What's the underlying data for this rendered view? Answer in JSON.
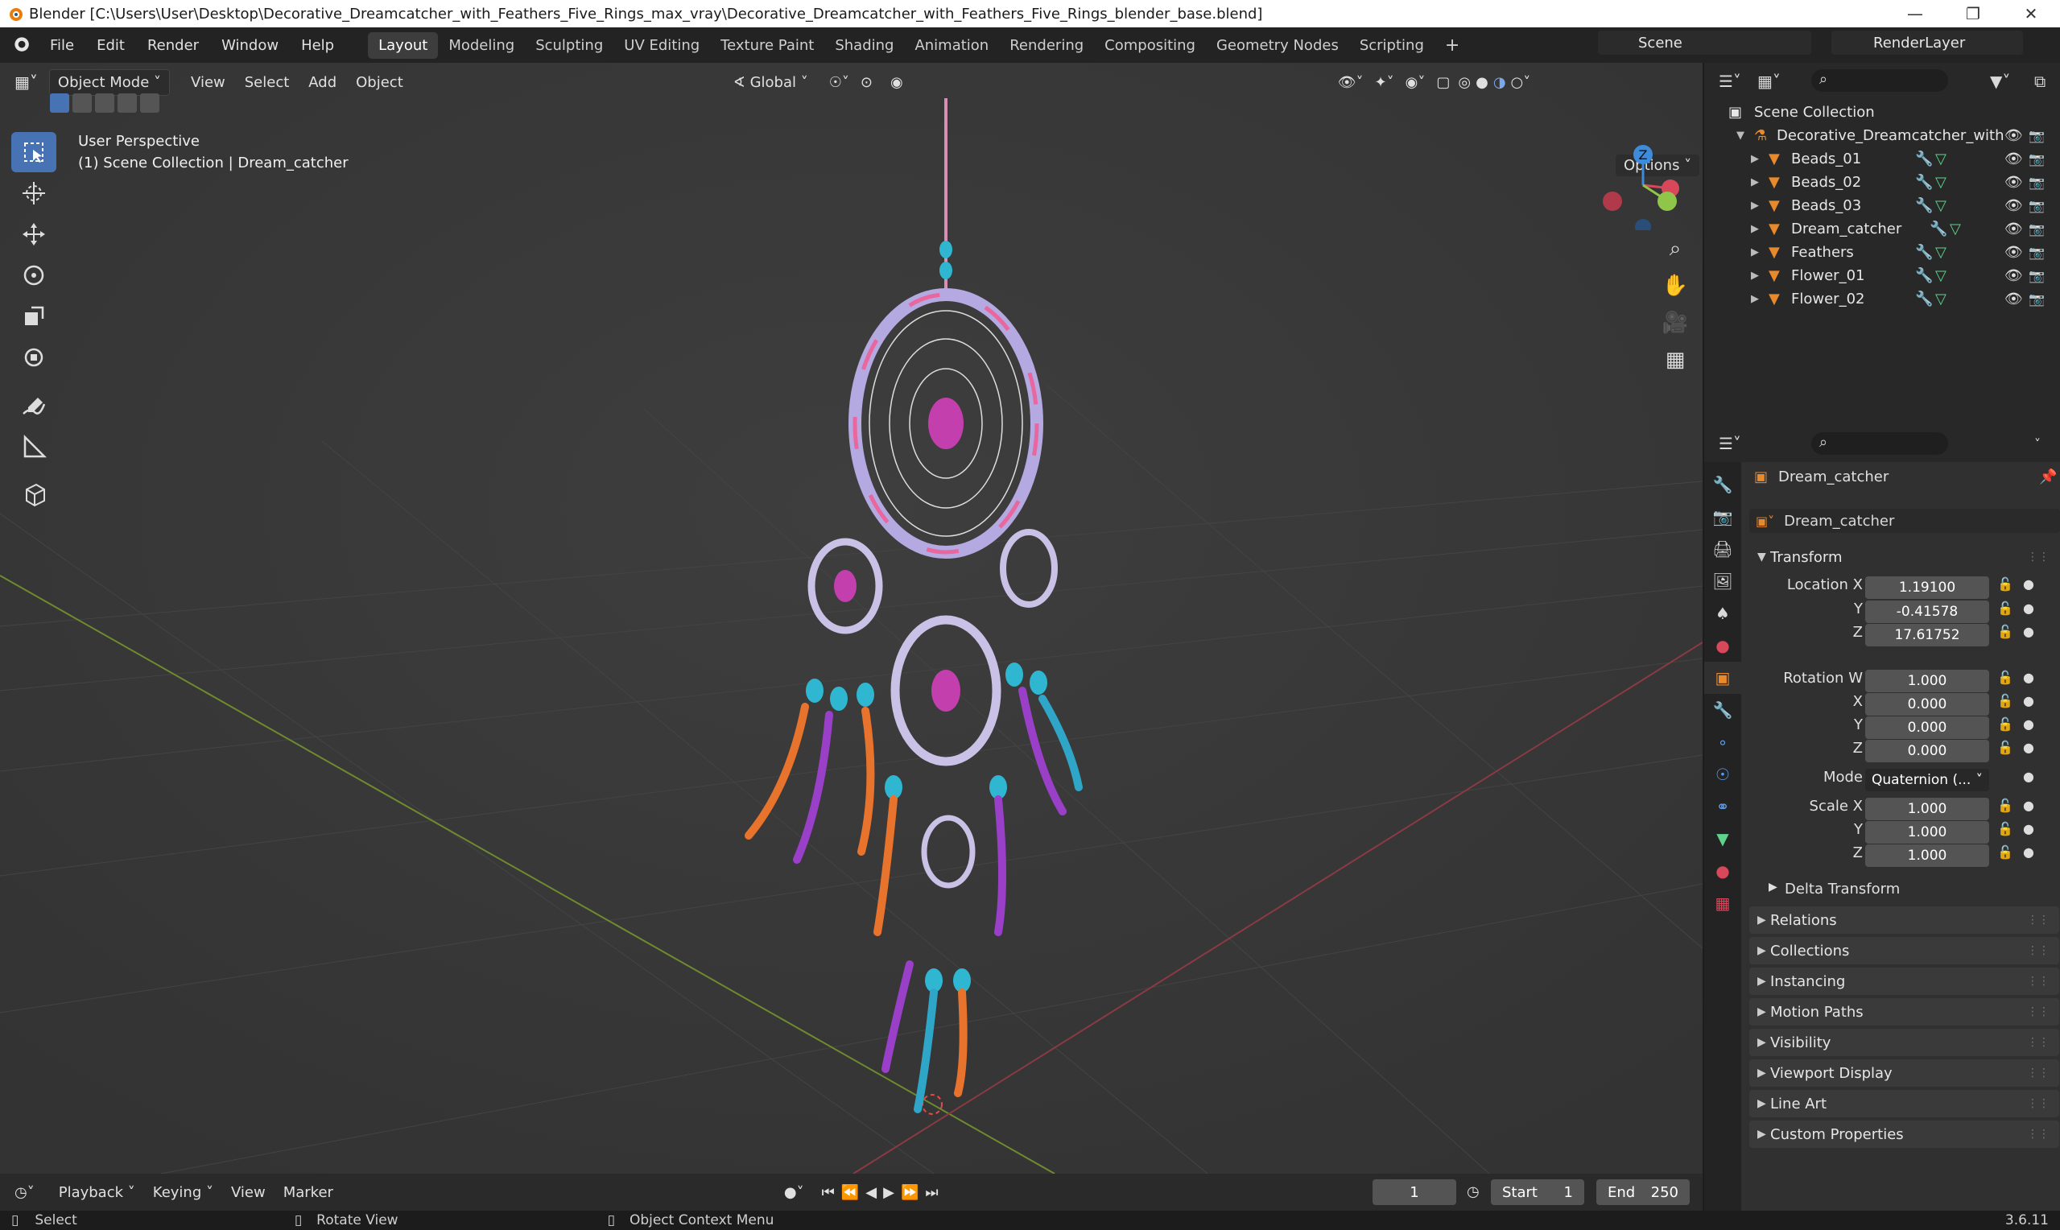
{
  "window": {
    "title": "Blender [C:\\Users\\User\\Desktop\\Decorative_Dreamcatcher_with_Feathers_Five_Rings_max_vray\\Decorative_Dreamcatcher_with_Feathers_Five_Rings_blender_base.blend]"
  },
  "menu": {
    "items": [
      "File",
      "Edit",
      "Render",
      "Window",
      "Help"
    ],
    "workspaces": [
      "Layout",
      "Modeling",
      "Sculpting",
      "UV Editing",
      "Texture Paint",
      "Shading",
      "Animation",
      "Rendering",
      "Compositing",
      "Geometry Nodes",
      "Scripting"
    ],
    "active_workspace": "Layout",
    "scene": "Scene",
    "render_layer": "RenderLayer"
  },
  "viewport": {
    "mode": "Object Mode",
    "menus": [
      "View",
      "Select",
      "Add",
      "Object"
    ],
    "transform_orientation": "Global",
    "options_label": "Options",
    "perspective": "User Perspective",
    "context": "(1) Scene Collection | Dream_catcher",
    "gizmo_axis": "Z"
  },
  "outliner": {
    "root": "Scene Collection",
    "collection": "Decorative_Dreamcatcher_with",
    "objects": [
      "Beads_01",
      "Beads_02",
      "Beads_03",
      "Dream_catcher",
      "Feathers",
      "Flower_01",
      "Flower_02"
    ]
  },
  "properties": {
    "object_name": "Dream_catcher",
    "datablock": "Dream_catcher",
    "transform_header": "Transform",
    "location": {
      "label": "Location X",
      "x": "1.19100",
      "y": "-0.41578",
      "z": "17.61752"
    },
    "rotation": {
      "label": "Rotation W",
      "w": "1.000",
      "x": "0.000",
      "y": "0.000",
      "z": "0.000"
    },
    "mode": {
      "label": "Mode",
      "value": "Quaternion (..."
    },
    "scale": {
      "label": "Scale X",
      "x": "1.000",
      "y": "1.000",
      "z": "1.000"
    },
    "axis_labels": {
      "y": "Y",
      "z": "Z",
      "x": "X"
    },
    "delta": "Delta Transform",
    "panels": [
      "Relations",
      "Collections",
      "Instancing",
      "Motion Paths",
      "Visibility",
      "Viewport Display",
      "Line Art",
      "Custom Properties"
    ]
  },
  "timeline": {
    "menus": [
      "Playback",
      "Keying",
      "View",
      "Marker"
    ],
    "current_frame": "1",
    "start_label": "Start",
    "start": "1",
    "end_label": "End",
    "end": "250"
  },
  "statusbar": {
    "select": "Select",
    "rotate": "Rotate View",
    "context": "Object Context Menu",
    "version": "3.6.11"
  },
  "colors": {
    "accent": "#4772b3",
    "object_orange": "#e8892c",
    "mesh_green": "#5fd38c",
    "axis_x": "#d9475b",
    "axis_y": "#8fc649",
    "axis_z": "#3d8bd9"
  }
}
